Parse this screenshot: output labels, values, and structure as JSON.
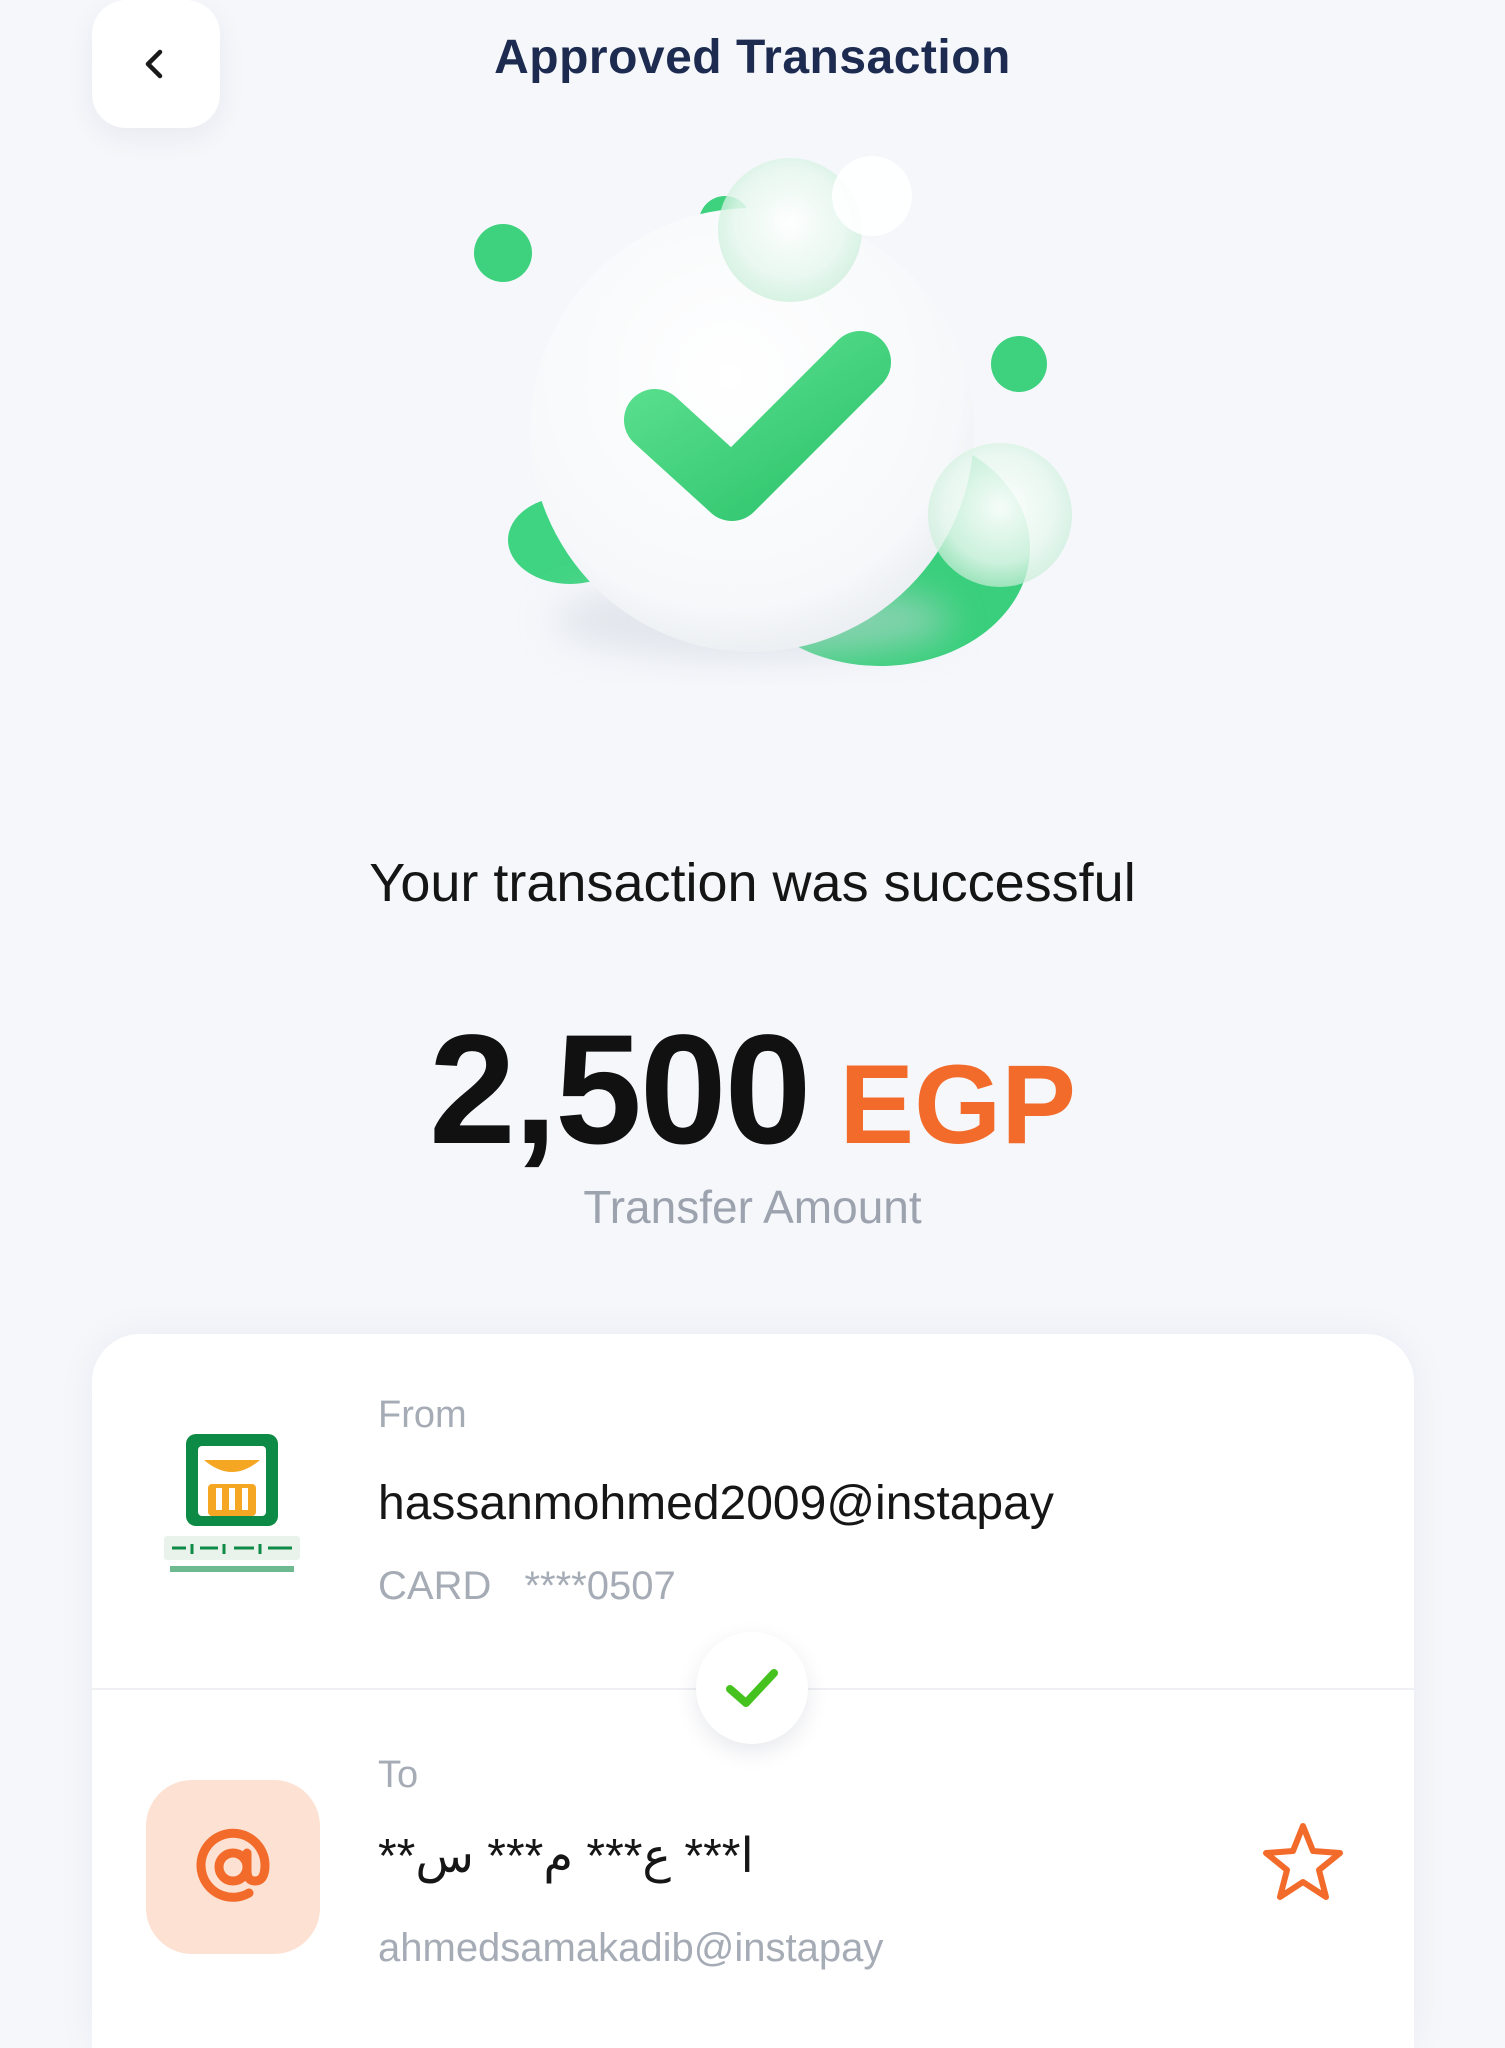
{
  "header": {
    "title": "Approved Transaction",
    "back_icon": "chevron-left-icon"
  },
  "hero": {
    "icon": "success-check-illustration",
    "colors": {
      "green": "#3ed17e",
      "green_light": "#62dd95"
    }
  },
  "message": "Your transaction was successful",
  "amount": {
    "value": "2,500",
    "currency": "EGP",
    "label": "Transfer Amount",
    "currency_color": "#f26b2a"
  },
  "transfer": {
    "from": {
      "label": "From",
      "address": "hassanmohmed2009@instapay",
      "card_label": "CARD",
      "card_number": "****0507",
      "logo": "bank-logo"
    },
    "status_icon": "check-icon",
    "to": {
      "label": "To",
      "name": "ا*** ع*** م*** س**",
      "address": "ahmedsamakadib@instapay",
      "avatar_icon": "at-sign-icon",
      "favorite_icon": "star-outline-icon"
    }
  },
  "colors": {
    "accent": "#f26b2a",
    "success": "#3ed17e",
    "title": "#1c2b4f",
    "muted": "#a6acb6"
  }
}
